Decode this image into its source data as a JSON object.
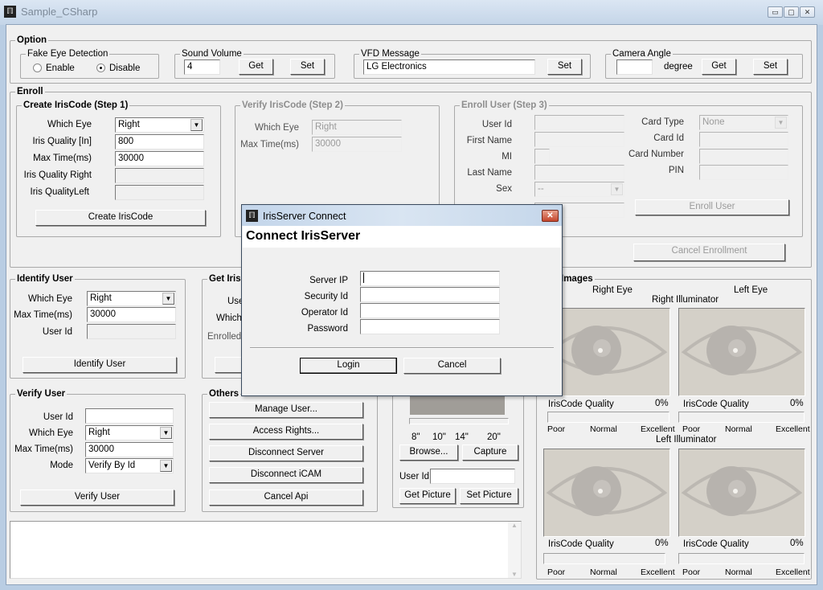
{
  "window": {
    "title": "Sample_CSharp",
    "minimize": "▭",
    "maximize": "▢",
    "close": "✕"
  },
  "option": {
    "title": "Option",
    "fake_eye": {
      "title": "Fake Eye Detection",
      "enable": "Enable",
      "disable": "Disable",
      "selected": "Disable"
    },
    "sound": {
      "title": "Sound Volume",
      "value": "4",
      "get": "Get",
      "set": "Set"
    },
    "vfd": {
      "title": "VFD Message",
      "value": "LG Electronics",
      "set": "Set"
    },
    "camera": {
      "title": "Camera Angle",
      "value": "",
      "unit": "degree",
      "get": "Get",
      "set": "Set"
    }
  },
  "enroll": {
    "title": "Enroll",
    "step1": {
      "title": "Create IrisCode (Step 1)",
      "which_eye_label": "Which Eye",
      "which_eye": "Right",
      "quality_in_label": "Iris Quality [In]",
      "quality_in": "800",
      "max_time_label": "Max Time(ms)",
      "max_time": "30000",
      "quality_right_label": "Iris Quality Right",
      "quality_left_label": "Iris QualityLeft",
      "button": "Create IrisCode"
    },
    "step2": {
      "title": "Verify IrisCode (Step 2)",
      "which_eye_label": "Which Eye",
      "which_eye": "Right",
      "max_time_label": "Max Time(ms)",
      "max_time": "30000"
    },
    "step3": {
      "title": "Enroll User (Step 3)",
      "user_id": "User Id",
      "first_name": "First Name",
      "mi": "MI",
      "last_name": "Last Name",
      "sex": "Sex",
      "sex_value": "--",
      "card_type": "Card Type",
      "card_type_value": "None",
      "card_id": "Card Id",
      "card_number": "Card Number",
      "pin": "PIN",
      "enroll_button": "Enroll User"
    },
    "cancel_button": "Cancel Enrollment"
  },
  "identify": {
    "title": "Identify User",
    "which_eye_label": "Which Eye",
    "which_eye": "Right",
    "max_time_label": "Max Time(ms)",
    "max_time": "30000",
    "user_id_label": "User Id",
    "button": "Identify User"
  },
  "get_iris": {
    "title": "Get Iris",
    "user_label": "Use",
    "which_label": "Which",
    "enrolled_label": "Enrolled"
  },
  "verify": {
    "title": "Verify User",
    "user_id_label": "User Id",
    "user_id": "",
    "which_eye_label": "Which Eye",
    "which_eye": "Right",
    "max_time_label": "Max Time(ms)",
    "max_time": "30000",
    "mode_label": "Mode",
    "mode": "Verify By Id",
    "button": "Verify User"
  },
  "others": {
    "title": "Others",
    "buttons": [
      "Manage User...",
      "Access Rights...",
      "Disconnect Server",
      "Disconnect iCAM",
      "Cancel Api"
    ]
  },
  "picture": {
    "distances": [
      "8\"",
      "10\"",
      "14\"",
      "20\""
    ],
    "browse": "Browse...",
    "capture": "Capture",
    "user_id_label": "User Id",
    "user_id": "",
    "get": "Get Picture",
    "set": "Set Picture"
  },
  "images": {
    "title": "Images",
    "right_eye": "Right Eye",
    "left_eye": "Left Eye",
    "right_illuminator": "Right Illuminator",
    "left_illuminator": "Left Illuminator",
    "quality_label": "IrisCode Quality",
    "scale": [
      "Poor",
      "Normal",
      "Excellent"
    ],
    "panels": [
      {
        "quality": "0%"
      },
      {
        "quality": "0%"
      },
      {
        "quality": "0%"
      },
      {
        "quality": "0%"
      }
    ]
  },
  "log": {
    "text": ""
  },
  "dialog": {
    "title": "IrisServer Connect",
    "header": "Connect IrisServer",
    "server_ip_label": "Server IP",
    "server_ip": "",
    "security_id_label": "Security Id",
    "security_id": "",
    "operator_id_label": "Operator Id",
    "operator_id": "",
    "password_label": "Password",
    "password": "",
    "login": "Login",
    "cancel": "Cancel"
  }
}
